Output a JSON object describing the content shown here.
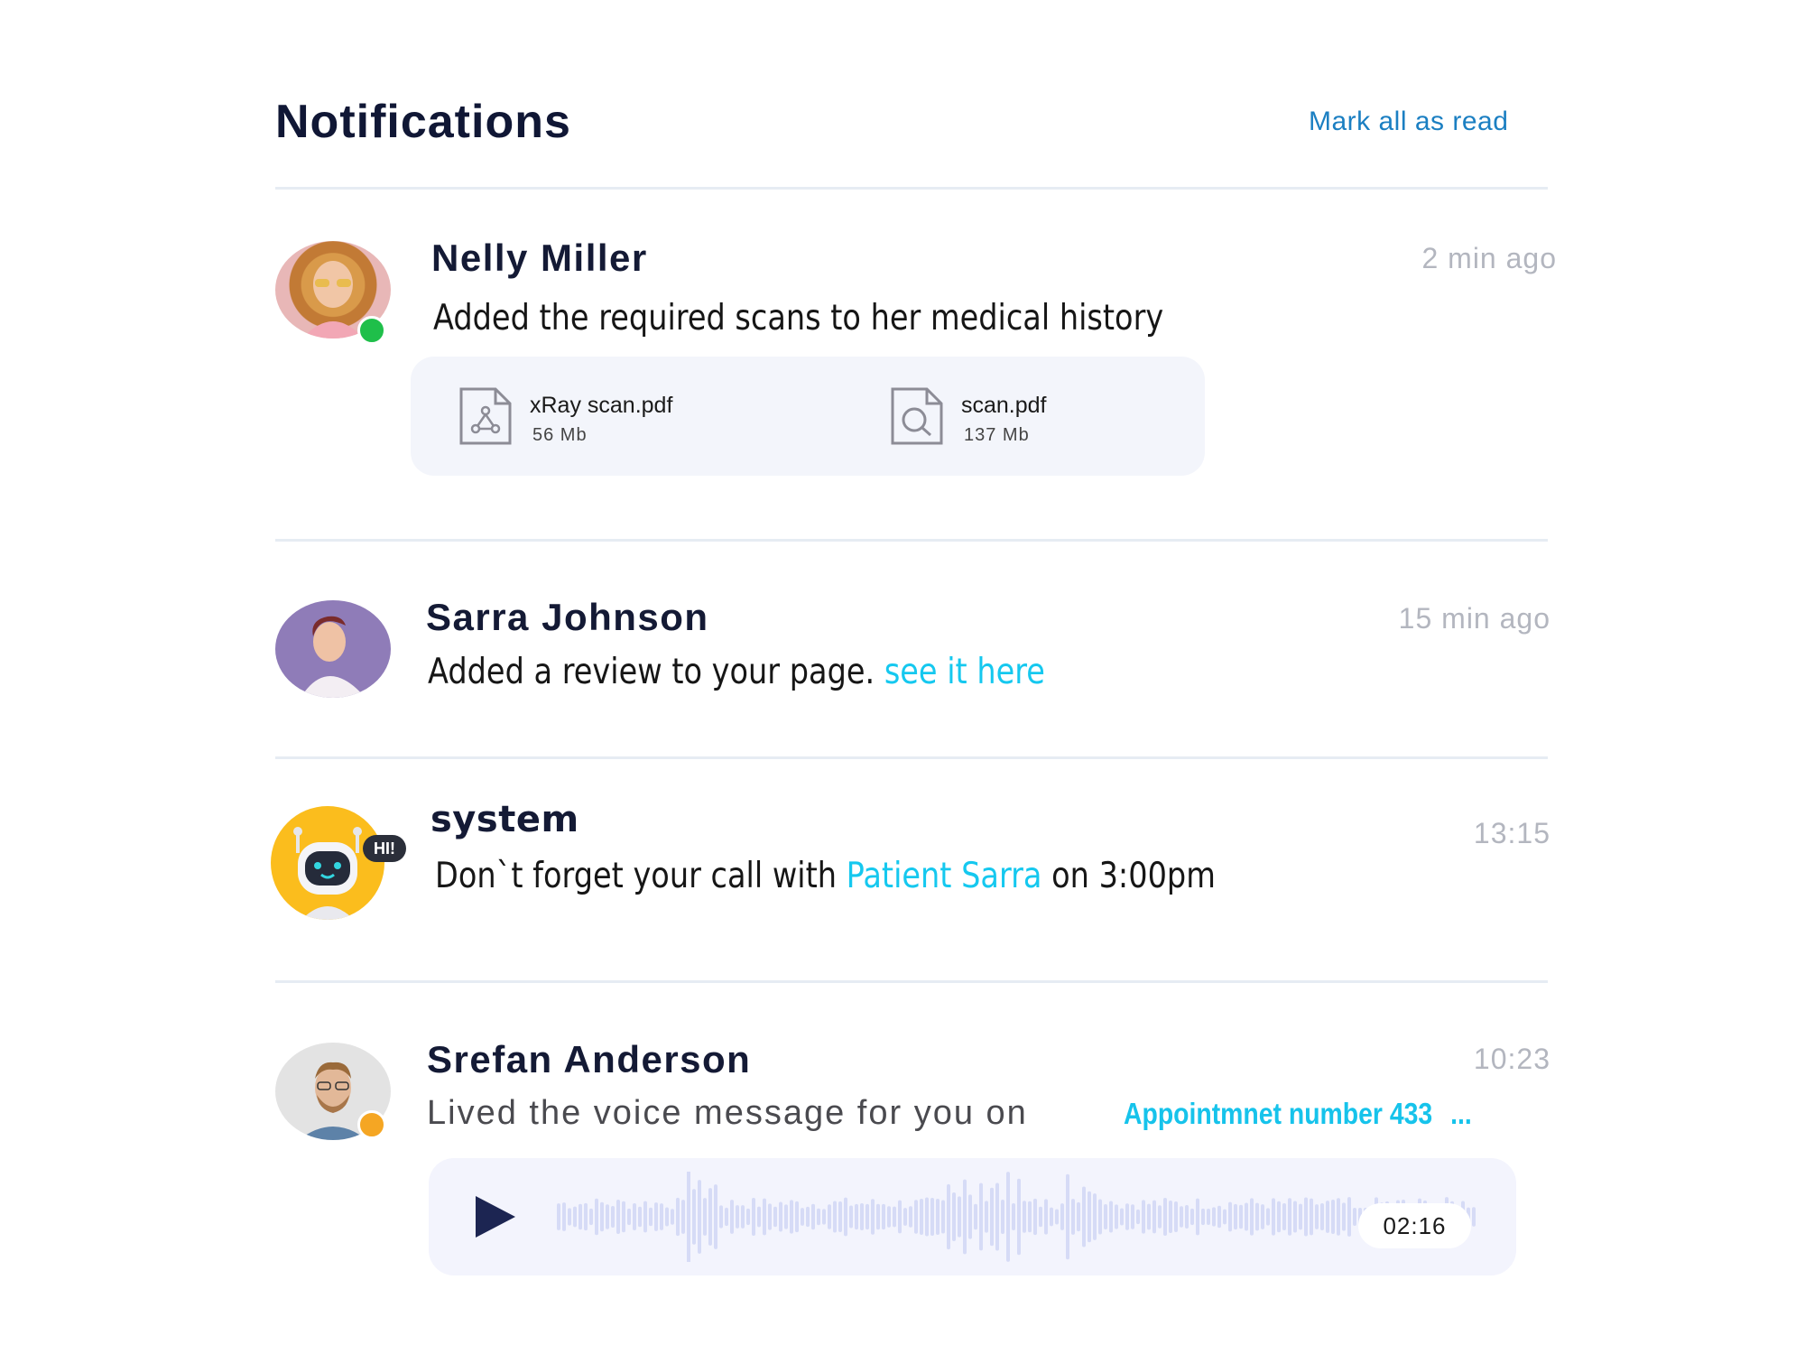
{
  "header": {
    "title": "Notifications",
    "mark_all_label": "Mark all as read"
  },
  "notifications": [
    {
      "name": "Nelly Miller",
      "time": "2 min ago",
      "message": "Added the  required scans to her medical history",
      "status_color": "#1fbf4a",
      "attachments": [
        {
          "filename": "xRay scan.pdf",
          "size": "56 Mb",
          "icon": "xray-file-icon"
        },
        {
          "filename": "scan.pdf",
          "size": "137 Mb",
          "icon": "search-file-icon"
        }
      ]
    },
    {
      "name": "Sarra Johnson",
      "time": "15 min ago",
      "message": "Added a review to your page. ",
      "link": "see it here"
    },
    {
      "name": "system",
      "time": "13:15",
      "message_before": "Don`t forget your call with ",
      "link": "Patient Sarra",
      "message_after": " on 3:00pm",
      "badge": "HI!"
    },
    {
      "name": "Srefan Anderson",
      "time": "10:23",
      "message": "Lived the voice message for you on",
      "link": "Appointmnet number 433",
      "ellipsis": "...",
      "status_color": "#f5a623",
      "voice": {
        "duration": "02:16",
        "icon": "play-icon"
      }
    }
  ],
  "colors": {
    "link": "#15c8ef",
    "accent": "#1b7fc2",
    "divider": "#e6ecf3"
  }
}
